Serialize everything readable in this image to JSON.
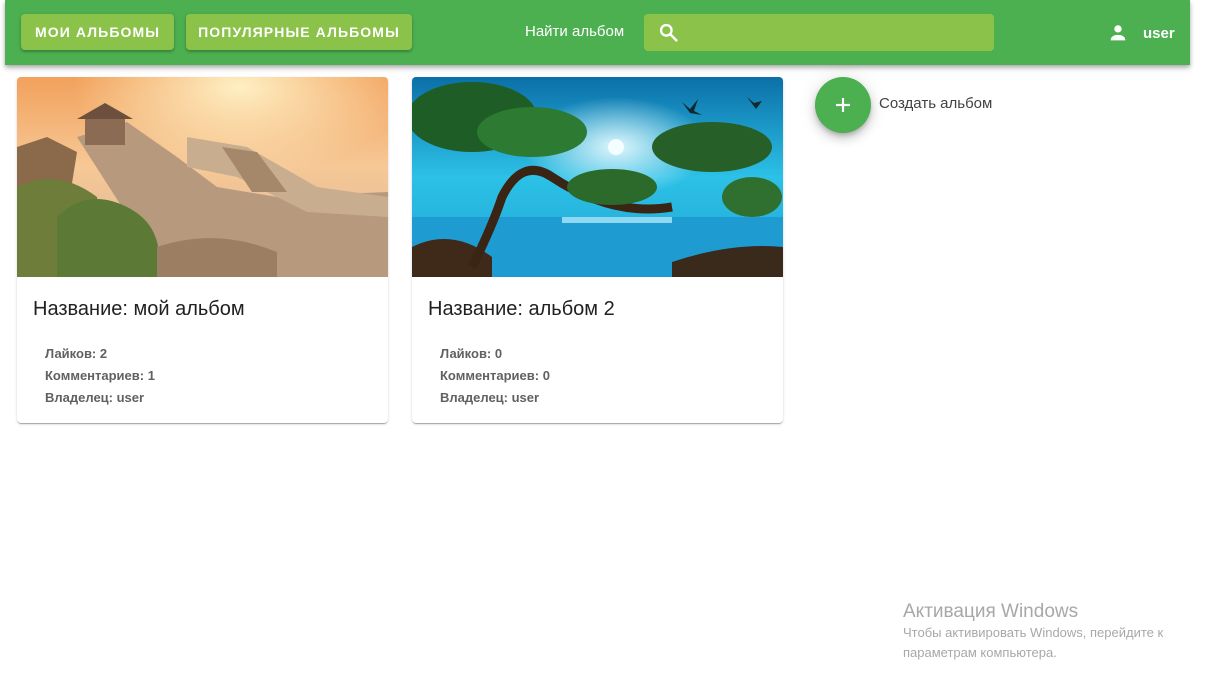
{
  "header": {
    "my_albums_label": "Мои альбомы",
    "popular_albums_label": "Популярные альбомы",
    "search_label": "Найти альбом",
    "search_value": "",
    "search_icon": "search-icon",
    "user_icon": "person-icon",
    "username": "user"
  },
  "albums": [
    {
      "title": "Название: мой альбом",
      "likes": "Лайков: 2",
      "comments": "Комментариев: 1",
      "owner": "Владелец: user",
      "image": "great-wall-photo"
    },
    {
      "title": "Название: альбом 2",
      "likes": "Лайков: 0",
      "comments": "Комментариев: 0",
      "owner": "Владелец: user",
      "image": "tree-lake-painting"
    }
  ],
  "create_album": {
    "icon": "plus-icon",
    "label": "Создать альбом"
  },
  "windows_watermark": {
    "title": "Активация Windows",
    "line1": "Чтобы активировать Windows, перейдите к",
    "line2": "параметрам компьютера."
  },
  "colors": {
    "primary": "#4caf50",
    "secondary": "#8bc34a"
  }
}
